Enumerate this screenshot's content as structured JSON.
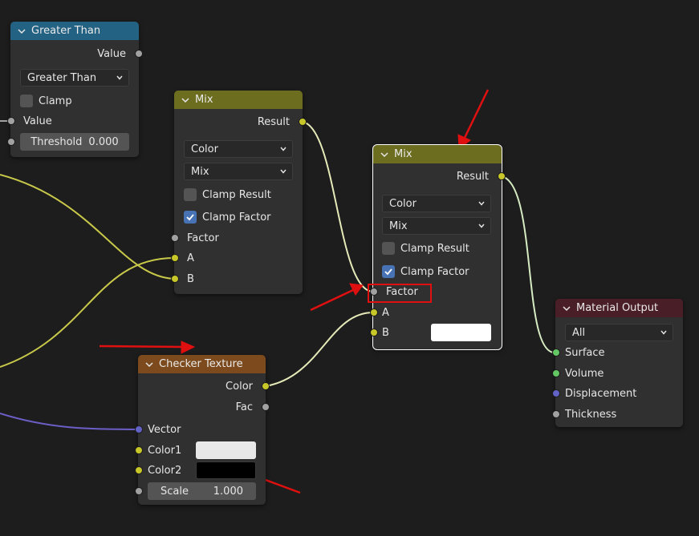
{
  "nodes": {
    "greater_than": {
      "title": "Greater Than",
      "header_color": "#246283",
      "output_value": "Value",
      "operation": "Greater Than",
      "clamp_label": "Clamp",
      "input_value": "Value",
      "threshold_label": "Threshold",
      "threshold_value": "0.000"
    },
    "mix_1": {
      "title": "Mix",
      "header_color": "#6d6d1f",
      "output_result": "Result",
      "data_type": "Color",
      "blend_mode": "Mix",
      "clamp_result_label": "Clamp Result",
      "clamp_factor_label": "Clamp Factor",
      "input_factor": "Factor",
      "input_a": "A",
      "input_b": "B"
    },
    "mix_2": {
      "title": "Mix",
      "header_color": "#6d6d1f",
      "output_result": "Result",
      "data_type": "Color",
      "blend_mode": "Mix",
      "clamp_result_label": "Clamp Result",
      "clamp_factor_label": "Clamp Factor",
      "input_factor": "Factor",
      "input_a": "A",
      "input_b": "B",
      "b_color": "#ffffff"
    },
    "checker": {
      "title": "Checker Texture",
      "header_color": "#7c4a1c",
      "output_color": "Color",
      "output_fac": "Fac",
      "input_vector": "Vector",
      "input_color1": "Color1",
      "input_color2": "Color2",
      "color1_value": "#e8e8e8",
      "color2_value": "#000000",
      "scale_label": "Scale",
      "scale_value": "1.000"
    },
    "material_output": {
      "title": "Material Output",
      "header_color": "#4a1e26",
      "target": "All",
      "input_surface": "Surface",
      "input_volume": "Volume",
      "input_displacement": "Displacement",
      "input_thickness": "Thickness"
    }
  },
  "colors": {
    "socket_color": "#c7c729",
    "socket_float": "#a1a1a1",
    "socket_vector": "#6363c7",
    "socket_shader": "#63c763",
    "link_color": "#c8c84a",
    "link_shader": "#d6ecc3",
    "link_vector": "#6b5fc7",
    "annotation": "#e01010"
  }
}
